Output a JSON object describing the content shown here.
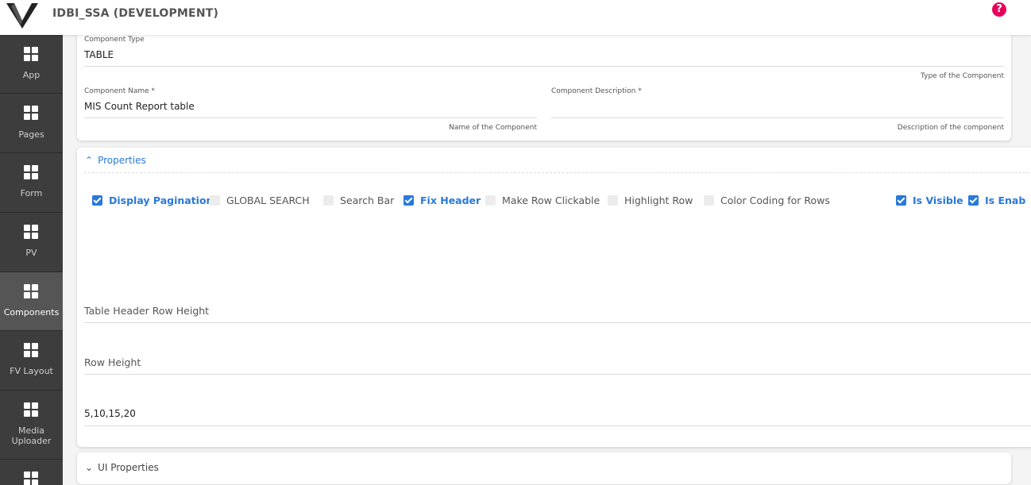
{
  "header": {
    "title": "IDBI_SSA (DEVELOPMENT)",
    "help_icon": "?",
    "brand_color": "#e6005c"
  },
  "sidebar": {
    "items": [
      {
        "label": "App",
        "icon": "grid-icon"
      },
      {
        "label": "Pages",
        "icon": "grid-icon"
      },
      {
        "label": "Form",
        "icon": "grid-icon"
      },
      {
        "label": "PV",
        "icon": "grid-icon"
      },
      {
        "label": "Components",
        "icon": "grid-icon",
        "active": true
      },
      {
        "label": "FV Layout",
        "icon": "grid-icon"
      },
      {
        "label": "Media Uploader",
        "icon": "grid-icon"
      }
    ]
  },
  "component": {
    "type_label": "Component Type",
    "type_value": "TABLE",
    "type_hint": "Type of the Component",
    "name_label": "Component Name *",
    "name_value": "MIS Count Report table",
    "name_hint": "Name of the Component",
    "desc_label": "Component Description *",
    "desc_value": "",
    "desc_hint": "Description of the component"
  },
  "properties": {
    "toggle_label": "Properties",
    "checkboxes": [
      {
        "label": "Display Pagination",
        "checked": true
      },
      {
        "label": "GLOBAL SEARCH",
        "checked": false
      },
      {
        "label": "Search Bar",
        "checked": false
      },
      {
        "label": "Fix Header",
        "checked": true
      },
      {
        "label": "Make Row Clickable",
        "checked": false
      },
      {
        "label": "Highlight Row",
        "checked": false
      },
      {
        "label": "Color Coding for Rows",
        "checked": false
      },
      {
        "label": "Is Visible",
        "checked": true
      },
      {
        "label": "Is Enab",
        "checked": true
      }
    ],
    "table_header_row_height_label": "Table Header Row Height",
    "table_header_row_height_value": "",
    "row_height_label": "Row Height",
    "row_height_value": "",
    "pagination_options_value": "5,10,15,20"
  },
  "ui_properties": {
    "toggle_label": "UI Properties"
  },
  "colors": {
    "accent": "#2979d9",
    "sidebar_bg": "#3d3d3d",
    "sidebar_active": "#555555"
  }
}
